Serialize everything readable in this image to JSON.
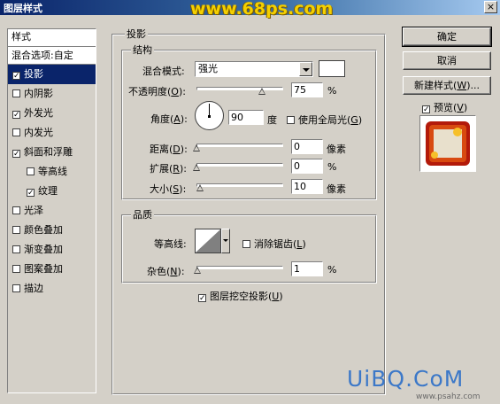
{
  "window": {
    "title": "图层样式",
    "close_glyph": "×"
  },
  "watermark_top": "www.68ps.com",
  "styles_panel": {
    "header": "样式",
    "blend_options": "混合选项:自定",
    "items": [
      {
        "label": "投影",
        "checked": true,
        "mark": "✓",
        "selected": true
      },
      {
        "label": "内阴影",
        "checked": false,
        "mark": ""
      },
      {
        "label": "外发光",
        "checked": true,
        "mark": "✓"
      },
      {
        "label": "内发光",
        "checked": false,
        "mark": ""
      },
      {
        "label": "斜面和浮雕",
        "checked": true,
        "mark": "✓"
      },
      {
        "label": "等高线",
        "checked": false,
        "mark": "",
        "sub": true
      },
      {
        "label": "纹理",
        "checked": true,
        "mark": "✓",
        "sub": true
      },
      {
        "label": "光泽",
        "checked": false,
        "mark": ""
      },
      {
        "label": "颜色叠加",
        "checked": false,
        "mark": ""
      },
      {
        "label": "渐变叠加",
        "checked": false,
        "mark": ""
      },
      {
        "label": "图案叠加",
        "checked": false,
        "mark": ""
      },
      {
        "label": "描边",
        "checked": false,
        "mark": ""
      }
    ]
  },
  "drop_shadow": {
    "title": "投影",
    "structure": {
      "title": "结构",
      "blend_mode_label": "混合模式:",
      "blend_mode_value": "强光",
      "opacity_label": "不透明度(",
      "opacity_key": "O",
      "opacity_label_end": "):",
      "opacity_value": "75",
      "opacity_unit": "%",
      "opacity_level": 0.75,
      "angle_label": "角度(",
      "angle_key": "A",
      "angle_label_end": "):",
      "angle_value": "90",
      "angle_unit": "度",
      "global_light_label": "使用全局光(",
      "global_light_key": "G",
      "global_light_label_end": ")",
      "distance_label": "距离(",
      "distance_key": "D",
      "distance_label_end": "):",
      "distance_value": "0",
      "distance_unit": "像素",
      "distance_level": 0,
      "spread_label": "扩展(",
      "spread_key": "R",
      "spread_label_end": "):",
      "spread_value": "0",
      "spread_unit": "%",
      "spread_level": 0,
      "size_label": "大小(",
      "size_key": "S",
      "size_label_end": "):",
      "size_value": "10",
      "size_unit": "像素",
      "size_level": 0.04
    },
    "quality": {
      "title": "品质",
      "contour_label": "等高线:",
      "antialias_label": "消除锯齿(",
      "antialias_key": "L",
      "antialias_label_end": ")",
      "noise_label": "杂色(",
      "noise_key": "N",
      "noise_label_end": "):",
      "noise_value": "1",
      "noise_unit": "%",
      "noise_level": 0.01
    },
    "knockout_label": "图层挖空投影(",
    "knockout_key": "U",
    "knockout_label_end": ")",
    "knockout_mark": "✓"
  },
  "buttons": {
    "ok": "确定",
    "cancel": "取消",
    "new_style": "新建样式(",
    "new_style_key": "W",
    "new_style_end": ")...",
    "preview_label": "预览(",
    "preview_key": "V",
    "preview_end": ")",
    "preview_mark": "✓"
  },
  "watermark_bottom": "UiBQ.CoM",
  "watermark_small": "www.psahz.com"
}
